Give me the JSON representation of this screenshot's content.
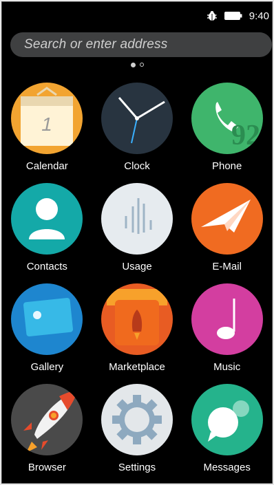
{
  "status_bar": {
    "time": "9:40",
    "icons": [
      "bug-icon",
      "battery-icon"
    ]
  },
  "search": {
    "placeholder": "Search or enter address"
  },
  "page_indicator": {
    "pages": 2,
    "current": 1
  },
  "apps": [
    {
      "label": "Calendar",
      "icon": "calendar-icon",
      "color": "#f2a431",
      "extra_text": "1"
    },
    {
      "label": "Clock",
      "icon": "clock-icon",
      "color": "#283440"
    },
    {
      "label": "Phone",
      "icon": "phone-icon",
      "color": "#3fb56c"
    },
    {
      "label": "Contacts",
      "icon": "contacts-icon",
      "color": "#14a9a8"
    },
    {
      "label": "Usage",
      "icon": "usage-icon",
      "color": "#e6ebef"
    },
    {
      "label": "E-Mail",
      "icon": "email-icon",
      "color": "#f06b21"
    },
    {
      "label": "Gallery",
      "icon": "gallery-icon",
      "color": "#1e86cf"
    },
    {
      "label": "Marketplace",
      "icon": "marketplace-icon",
      "color": "#e85c23"
    },
    {
      "label": "Music",
      "icon": "music-icon",
      "color": "#d33ea0"
    },
    {
      "label": "Browser",
      "icon": "browser-icon",
      "color": "#4a4a4a"
    },
    {
      "label": "Settings",
      "icon": "settings-icon",
      "color": "#e3e7ea"
    },
    {
      "label": "Messages",
      "icon": "messages-icon",
      "color": "#25b38c"
    }
  ]
}
